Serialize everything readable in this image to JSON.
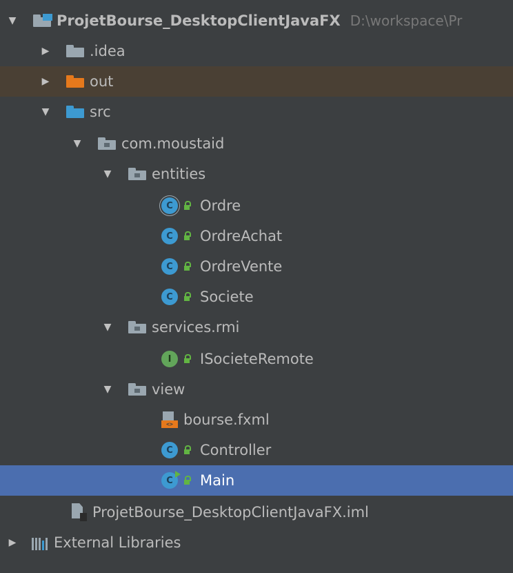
{
  "project": {
    "name": "ProjetBourse_DesktopClientJavaFX",
    "path": "D:\\workspace\\Pr"
  },
  "tree": {
    "idea": ".idea",
    "out": "out",
    "src": "src",
    "package": "com.moustaid",
    "entities": "entities",
    "entities_items": [
      "Ordre",
      "OrdreAchat",
      "OrdreVente",
      "Societe"
    ],
    "services": "services.rmi",
    "services_items": [
      "ISocieteRemote"
    ],
    "view": "view",
    "view_fxml": "bourse.fxml",
    "view_controller": "Controller",
    "view_main": "Main",
    "iml": "ProjetBourse_DesktopClientJavaFX.iml",
    "external": "External Libraries"
  },
  "icons": {
    "expanded": "triangle-down-icon",
    "collapsed": "triangle-right-icon",
    "class": "C",
    "interface": "I"
  },
  "colors": {
    "background": "#3c3f41",
    "selection": "#4b6eaf",
    "excluded": "#4a4034",
    "folder_blue": "#3d9ad1",
    "folder_orange": "#e6791c"
  }
}
